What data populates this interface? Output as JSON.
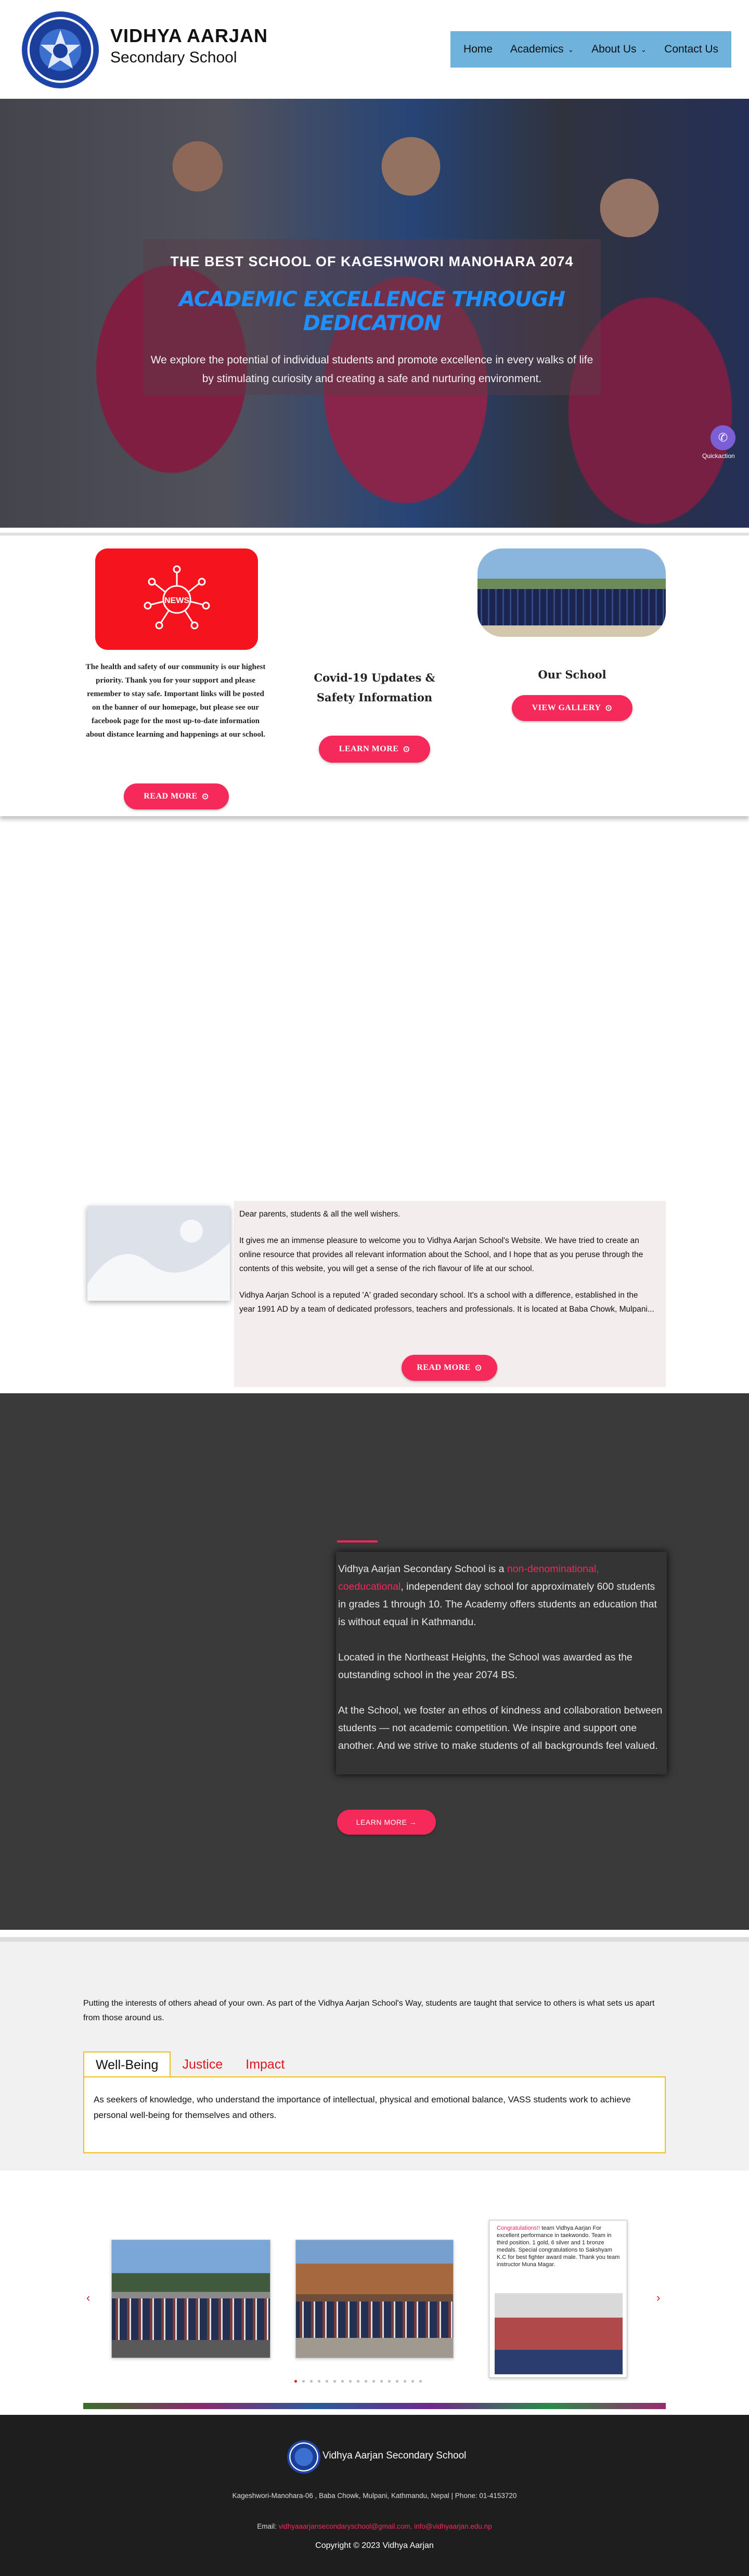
{
  "header": {
    "brand_title": "VIDHYA AARJAN",
    "brand_subtitle": "Secondary School",
    "nav": [
      {
        "label": "Home",
        "dropdown": false
      },
      {
        "label": "Academics",
        "dropdown": true
      },
      {
        "label": "About Us",
        "dropdown": true
      },
      {
        "label": "Contact Us",
        "dropdown": false
      }
    ],
    "nav_color": "#6fb3dc"
  },
  "hero": {
    "kicker": "THE BEST SCHOOL OF KAGESHWORI MANOHARA 2074",
    "headline": "ACADEMIC EXCELLENCE THROUGH DEDICATION",
    "text": "We explore the potential of individual students and promote excellence in every walks of life by stimulating curiosity and creating a safe and nurturing environment.",
    "widget_label": "Quickaction",
    "headline_color": "#1e90ff"
  },
  "cards": {
    "news_tile_label": "NEWS",
    "news_caption": "The health and safety of our community is our highest priority. Thank you for your support and please remember to stay safe. Important links will be posted on the banner of our homepage, but please see our facebook page for the most up-to-date information about distance learning and happenings at our school.",
    "news_button": "READ MORE",
    "covid_title": "Covid-19 Updates & Safety Information",
    "covid_button": "LEARN MORE",
    "school_title": "Our School",
    "gallery_button": "VIEW GALLERY",
    "accent_color": "#f52a5a"
  },
  "welcome": {
    "greeting": "Dear parents, students & all the well wishers.",
    "paragraph1": "It gives me an immense pleasure to welcome you to Vidhya Aarjan School's Website. We have tried to create an online resource that provides all relevant information about the School, and I hope that as you peruse through the contents of this website, you will get a sense of the rich flavour of life at our school.",
    "paragraph2": "Vidhya Aarjan School is a reputed 'A' graded secondary school. It's a school with a difference, established in the year 1991 AD by a team of dedicated professors, teachers and professionals. It is located at Baba Chowk, Mulpani...",
    "button": "READ MORE"
  },
  "about": {
    "p1_prefix": "Vidhya Aarjan Secondary School is a ",
    "p1_highlight": "non-denominational, coeducational",
    "p1_suffix": ", independent day school for approximately 600 students in grades 1 through 10. The Academy offers students an education that is without equal in Kathmandu.",
    "p2": "Located in the Northeast Heights, the School was awarded as the outstanding school in the year 2074 BS.",
    "p3": "At the School, we foster an ethos of kindness and collaboration between students — not academic competition. We inspire and support one another. And we strive to make students of all backgrounds feel valued.",
    "button": "LEARN MORE →"
  },
  "values": {
    "intro": "Putting the interests of others ahead of your own. As part of the Vidhya Aarjan School's Way, students are taught that service to others is what sets us apart from those around us.",
    "tabs": [
      {
        "label": "Well-Being",
        "active": true
      },
      {
        "label": "Justice",
        "active": false
      },
      {
        "label": "Impact",
        "active": false
      }
    ],
    "panel_text": "As seekers of knowledge, who understand the importance of intellectual, physical and emotional balance, VASS students work to achieve personal well-being for themselves and others."
  },
  "carousel": {
    "prev": "‹",
    "next": "›",
    "slide3_caption_highlight": "Congratulations!!",
    "slide3_caption": " team Vidhya Aarjan For excellent performance in taekwondo. Team in third position. 1 gold, 6 silver and 1 bronze medals. Special congratulations to Sakshyam K.C for best fighter award male. Thank you team instructor Muna Magar.",
    "dot_count": 17,
    "active_dot": 0
  },
  "footer": {
    "school_name": "Vidhya Aarjan Secondary School",
    "address": "Kageshwori-Manohara-06 , Baba Chowk, Mulpani, Kathmandu, Nepal | Phone: 01-4153720",
    "email_label": "Email: ",
    "email_value": "vidhyaaarjansecondaryschool@gmail.com, info@vidhyaarjan.edu.np",
    "copyright": "Copyright © 2023 Vidhya Aarjan"
  }
}
